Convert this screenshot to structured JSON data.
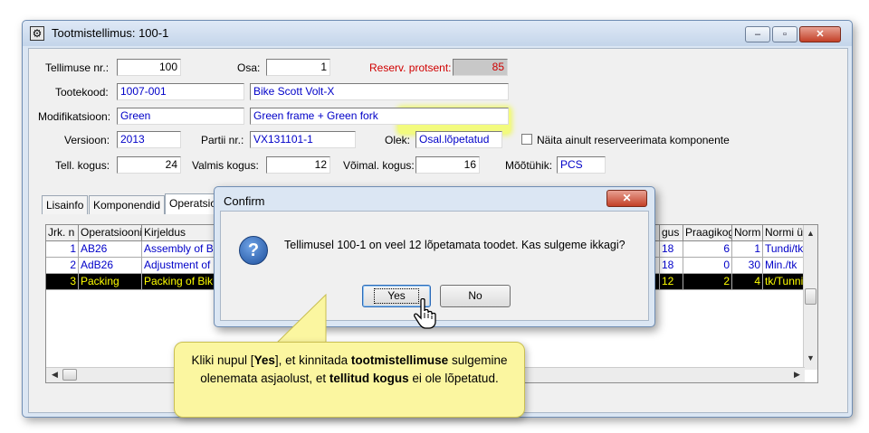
{
  "window": {
    "title": "Tootmistellimus: 100-1",
    "minimize": "–",
    "maximize": "▫",
    "close": "✕"
  },
  "form": {
    "order_no_label": "Tellimuse nr.:",
    "order_no": "100",
    "part_label": "Osa:",
    "part": "1",
    "reserve_label": "Reserv. protsent:",
    "reserve": "85",
    "product_code_label": "Tootekood:",
    "product_code": "1007-001",
    "product_name": "Bike Scott Volt-X",
    "modification_label": "Modifikatsioon:",
    "modification": "Green",
    "modification_desc": "Green frame + Green fork",
    "version_label": "Versioon:",
    "version": "2013",
    "batch_label": "Partii nr.:",
    "batch": "VX131101-1",
    "status_label": "Olek:",
    "status": "Osal.lõpetatud",
    "show_unreserved_label": "Näita ainult reserveerimata komponente",
    "total_qty_label": "Tell. kogus:",
    "total_qty": "24",
    "done_qty_label": "Valmis kogus:",
    "done_qty": "12",
    "possible_qty_label": "Võimal. kogus:",
    "possible_qty": "16",
    "unit_label": "Mõõtühik:",
    "unit": "PCS"
  },
  "tabs": [
    "Lisainfo",
    "Komponendid",
    "Operatsio"
  ],
  "grid": {
    "headers": [
      "Jrk. n",
      "Operatsiooni",
      "Kirjeldus",
      "gus",
      "Praagikog",
      "Norm",
      "Normi üh"
    ],
    "rows": [
      [
        "1",
        "AB26",
        "Assembly of Bi",
        "18",
        "6",
        "1",
        "Tundi/tk"
      ],
      [
        "2",
        "AdB26",
        "Adjustment of I",
        "18",
        "0",
        "30",
        "Min./tk"
      ],
      [
        "3",
        "Packing",
        "Packing of Bik",
        "12",
        "2",
        "4",
        "tk/Tunni"
      ]
    ]
  },
  "dialog": {
    "title": "Confirm",
    "close": "✕",
    "icon": "question-icon",
    "question_glyph": "?",
    "message": "Tellimusel 100-1 on veel 12 lõpetamata toodet. Kas sulgeme ikkagi?",
    "yes": "Yes",
    "no": "No"
  },
  "callout": {
    "t1": "Kliki nupul [",
    "t2": "Yes",
    "t3": "], et kinnitada ",
    "t4": "tootmistellimuse",
    "t5": " sulgemine olenemata asjaolust, et ",
    "t6": "tellitud kogus",
    "t7": " ei ole lõpetatud."
  },
  "colors": {
    "accent_blue": "#0000c8",
    "highlight": "#f3fb7e",
    "selected_row_fg": "#ffff00",
    "callout_bg": "#fbf6a0"
  }
}
